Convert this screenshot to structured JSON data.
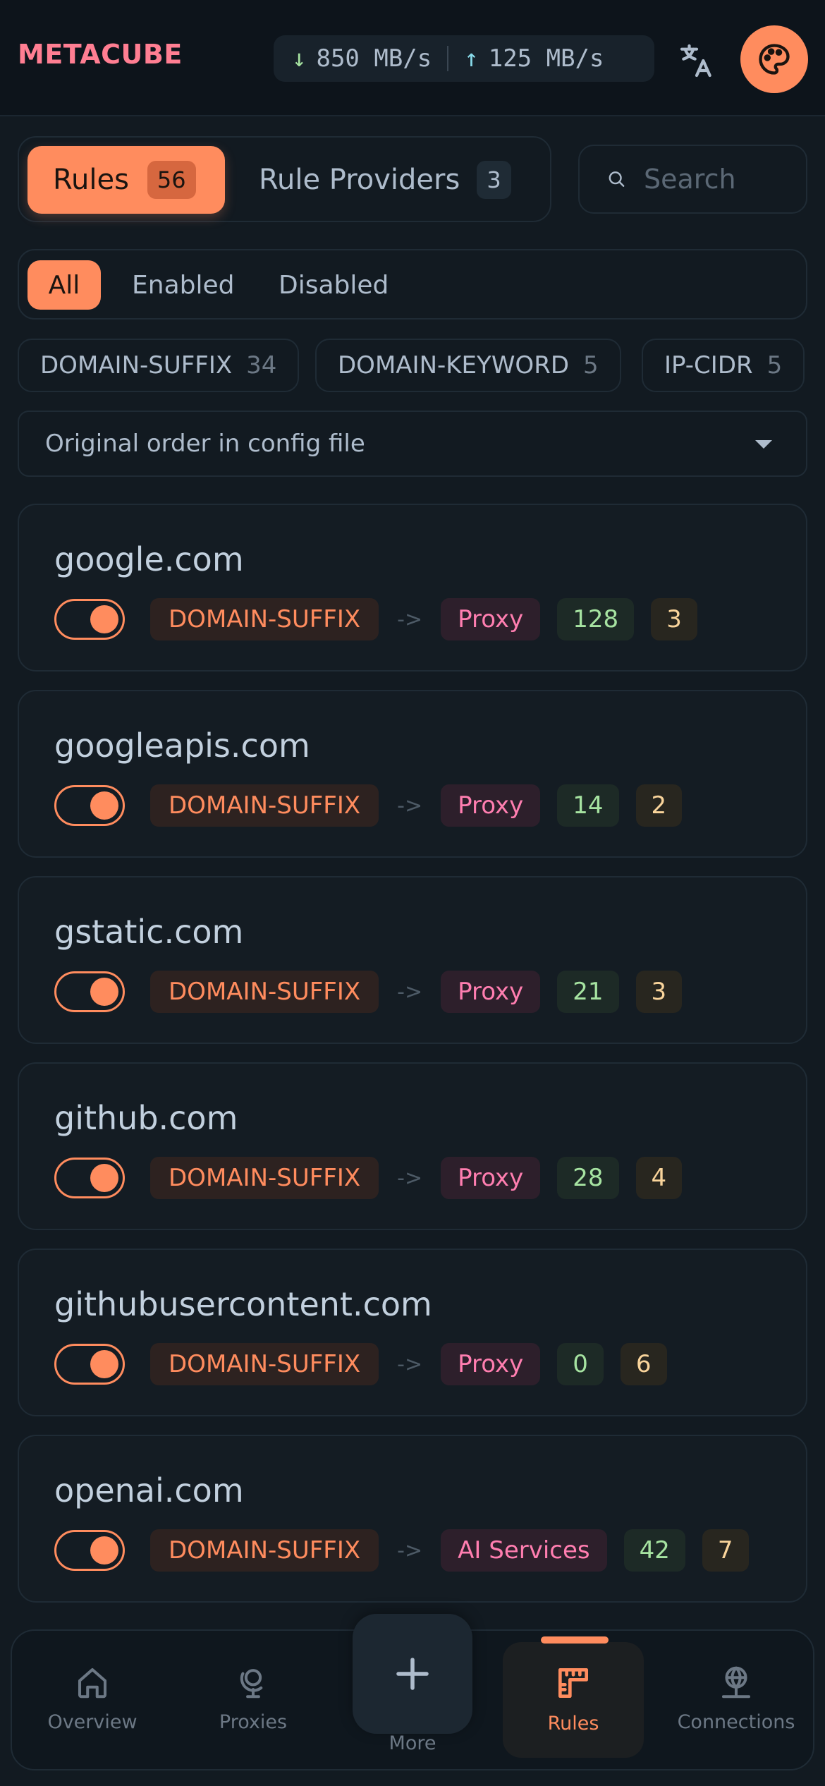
{
  "app": {
    "name": "METACUBE"
  },
  "traffic": {
    "download": "850 MB/s",
    "upload": "125 MB/s"
  },
  "colors": {
    "accent": "#ff8c5e",
    "brand": "#ff7e92",
    "background": "#121a21"
  },
  "tabs": [
    {
      "label": "Rules",
      "count": "56",
      "active": true
    },
    {
      "label": "Rule Providers",
      "count": "3",
      "active": false
    }
  ],
  "search": {
    "placeholder": "Search",
    "value": ""
  },
  "filters": {
    "all": "All",
    "enabled": "Enabled",
    "disabled": "Disabled",
    "selected": "All"
  },
  "types": [
    {
      "label": "DOMAIN-SUFFIX",
      "count": "34"
    },
    {
      "label": "DOMAIN-KEYWORD",
      "count": "5"
    },
    {
      "label": "IP-CIDR",
      "count": "5"
    }
  ],
  "sort": {
    "selected": "Original order in config file"
  },
  "arrow_text": "->",
  "rules": [
    {
      "payload": "google.com",
      "type": "DOMAIN-SUFFIX",
      "target": "Proxy",
      "hits": "128",
      "count": "3",
      "enabled": true
    },
    {
      "payload": "googleapis.com",
      "type": "DOMAIN-SUFFIX",
      "target": "Proxy",
      "hits": "14",
      "count": "2",
      "enabled": true
    },
    {
      "payload": "gstatic.com",
      "type": "DOMAIN-SUFFIX",
      "target": "Proxy",
      "hits": "21",
      "count": "3",
      "enabled": true
    },
    {
      "payload": "github.com",
      "type": "DOMAIN-SUFFIX",
      "target": "Proxy",
      "hits": "28",
      "count": "4",
      "enabled": true
    },
    {
      "payload": "githubusercontent.com",
      "type": "DOMAIN-SUFFIX",
      "target": "Proxy",
      "hits": "0",
      "count": "6",
      "enabled": true
    },
    {
      "payload": "openai.com",
      "type": "DOMAIN-SUFFIX",
      "target": "AI Services",
      "hits": "42",
      "count": "7",
      "enabled": true
    }
  ],
  "nav": {
    "overview": "Overview",
    "proxies": "Proxies",
    "more": "More",
    "rules": "Rules",
    "connections": "Connections",
    "active": "Rules"
  },
  "icons": {
    "download": "arrow-down-icon",
    "upload": "arrow-up-icon",
    "translate": "translate-icon",
    "theme": "palette-icon",
    "search": "search-icon",
    "sort": "chevron-down-icon",
    "overview": "home-icon",
    "proxies": "globe-stand-icon",
    "more": "plus-icon",
    "rules": "ruler-icon",
    "connections": "network-icon"
  }
}
